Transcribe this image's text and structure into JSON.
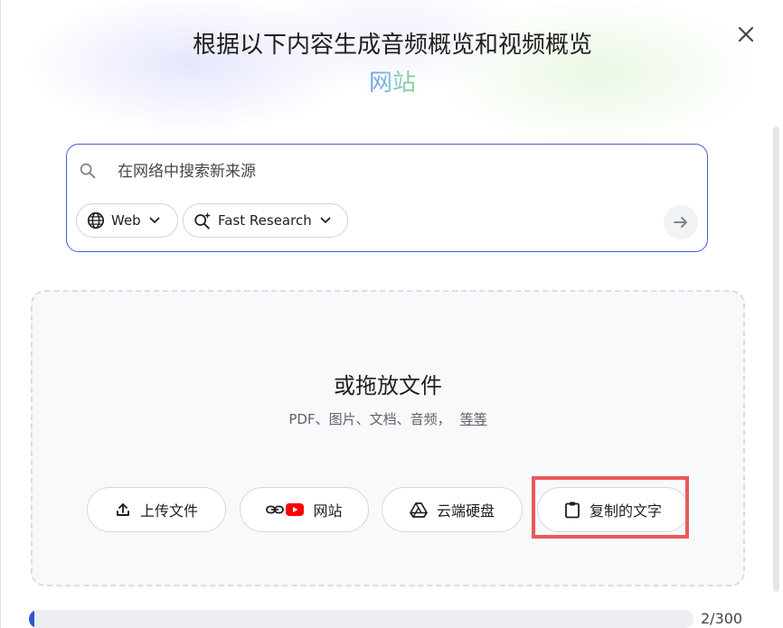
{
  "dialog": {
    "title": "根据以下内容生成音频概览和视频概览",
    "title_accent": "网站",
    "close_icon": "close-icon"
  },
  "search": {
    "placeholder": "在网络中搜索新来源",
    "source_chip": {
      "label": "Web",
      "icon": "globe-icon"
    },
    "mode_chip": {
      "label": "Fast Research",
      "icon": "sparkle-search-icon"
    },
    "submit_icon": "arrow-right-icon"
  },
  "drop_zone": {
    "title": "或拖放文件",
    "subtitle": "PDF、图片、文档、音频，",
    "more_link": "等等",
    "buttons": [
      {
        "label": "上传文件",
        "icon": "upload-icon"
      },
      {
        "label": "网站",
        "icon": "link-youtube-icon"
      },
      {
        "label": "云端硬盘",
        "icon": "drive-icon"
      },
      {
        "label": "复制的文字",
        "icon": "clipboard-icon"
      }
    ]
  },
  "source_limit": {
    "count_text": "2/300",
    "fraction": 0.0067
  },
  "colors": {
    "accent_blue": "#2f55d4",
    "search_border": "#4a5bd3",
    "highlight": "#e85a5a",
    "youtube_red": "#ff0000"
  }
}
